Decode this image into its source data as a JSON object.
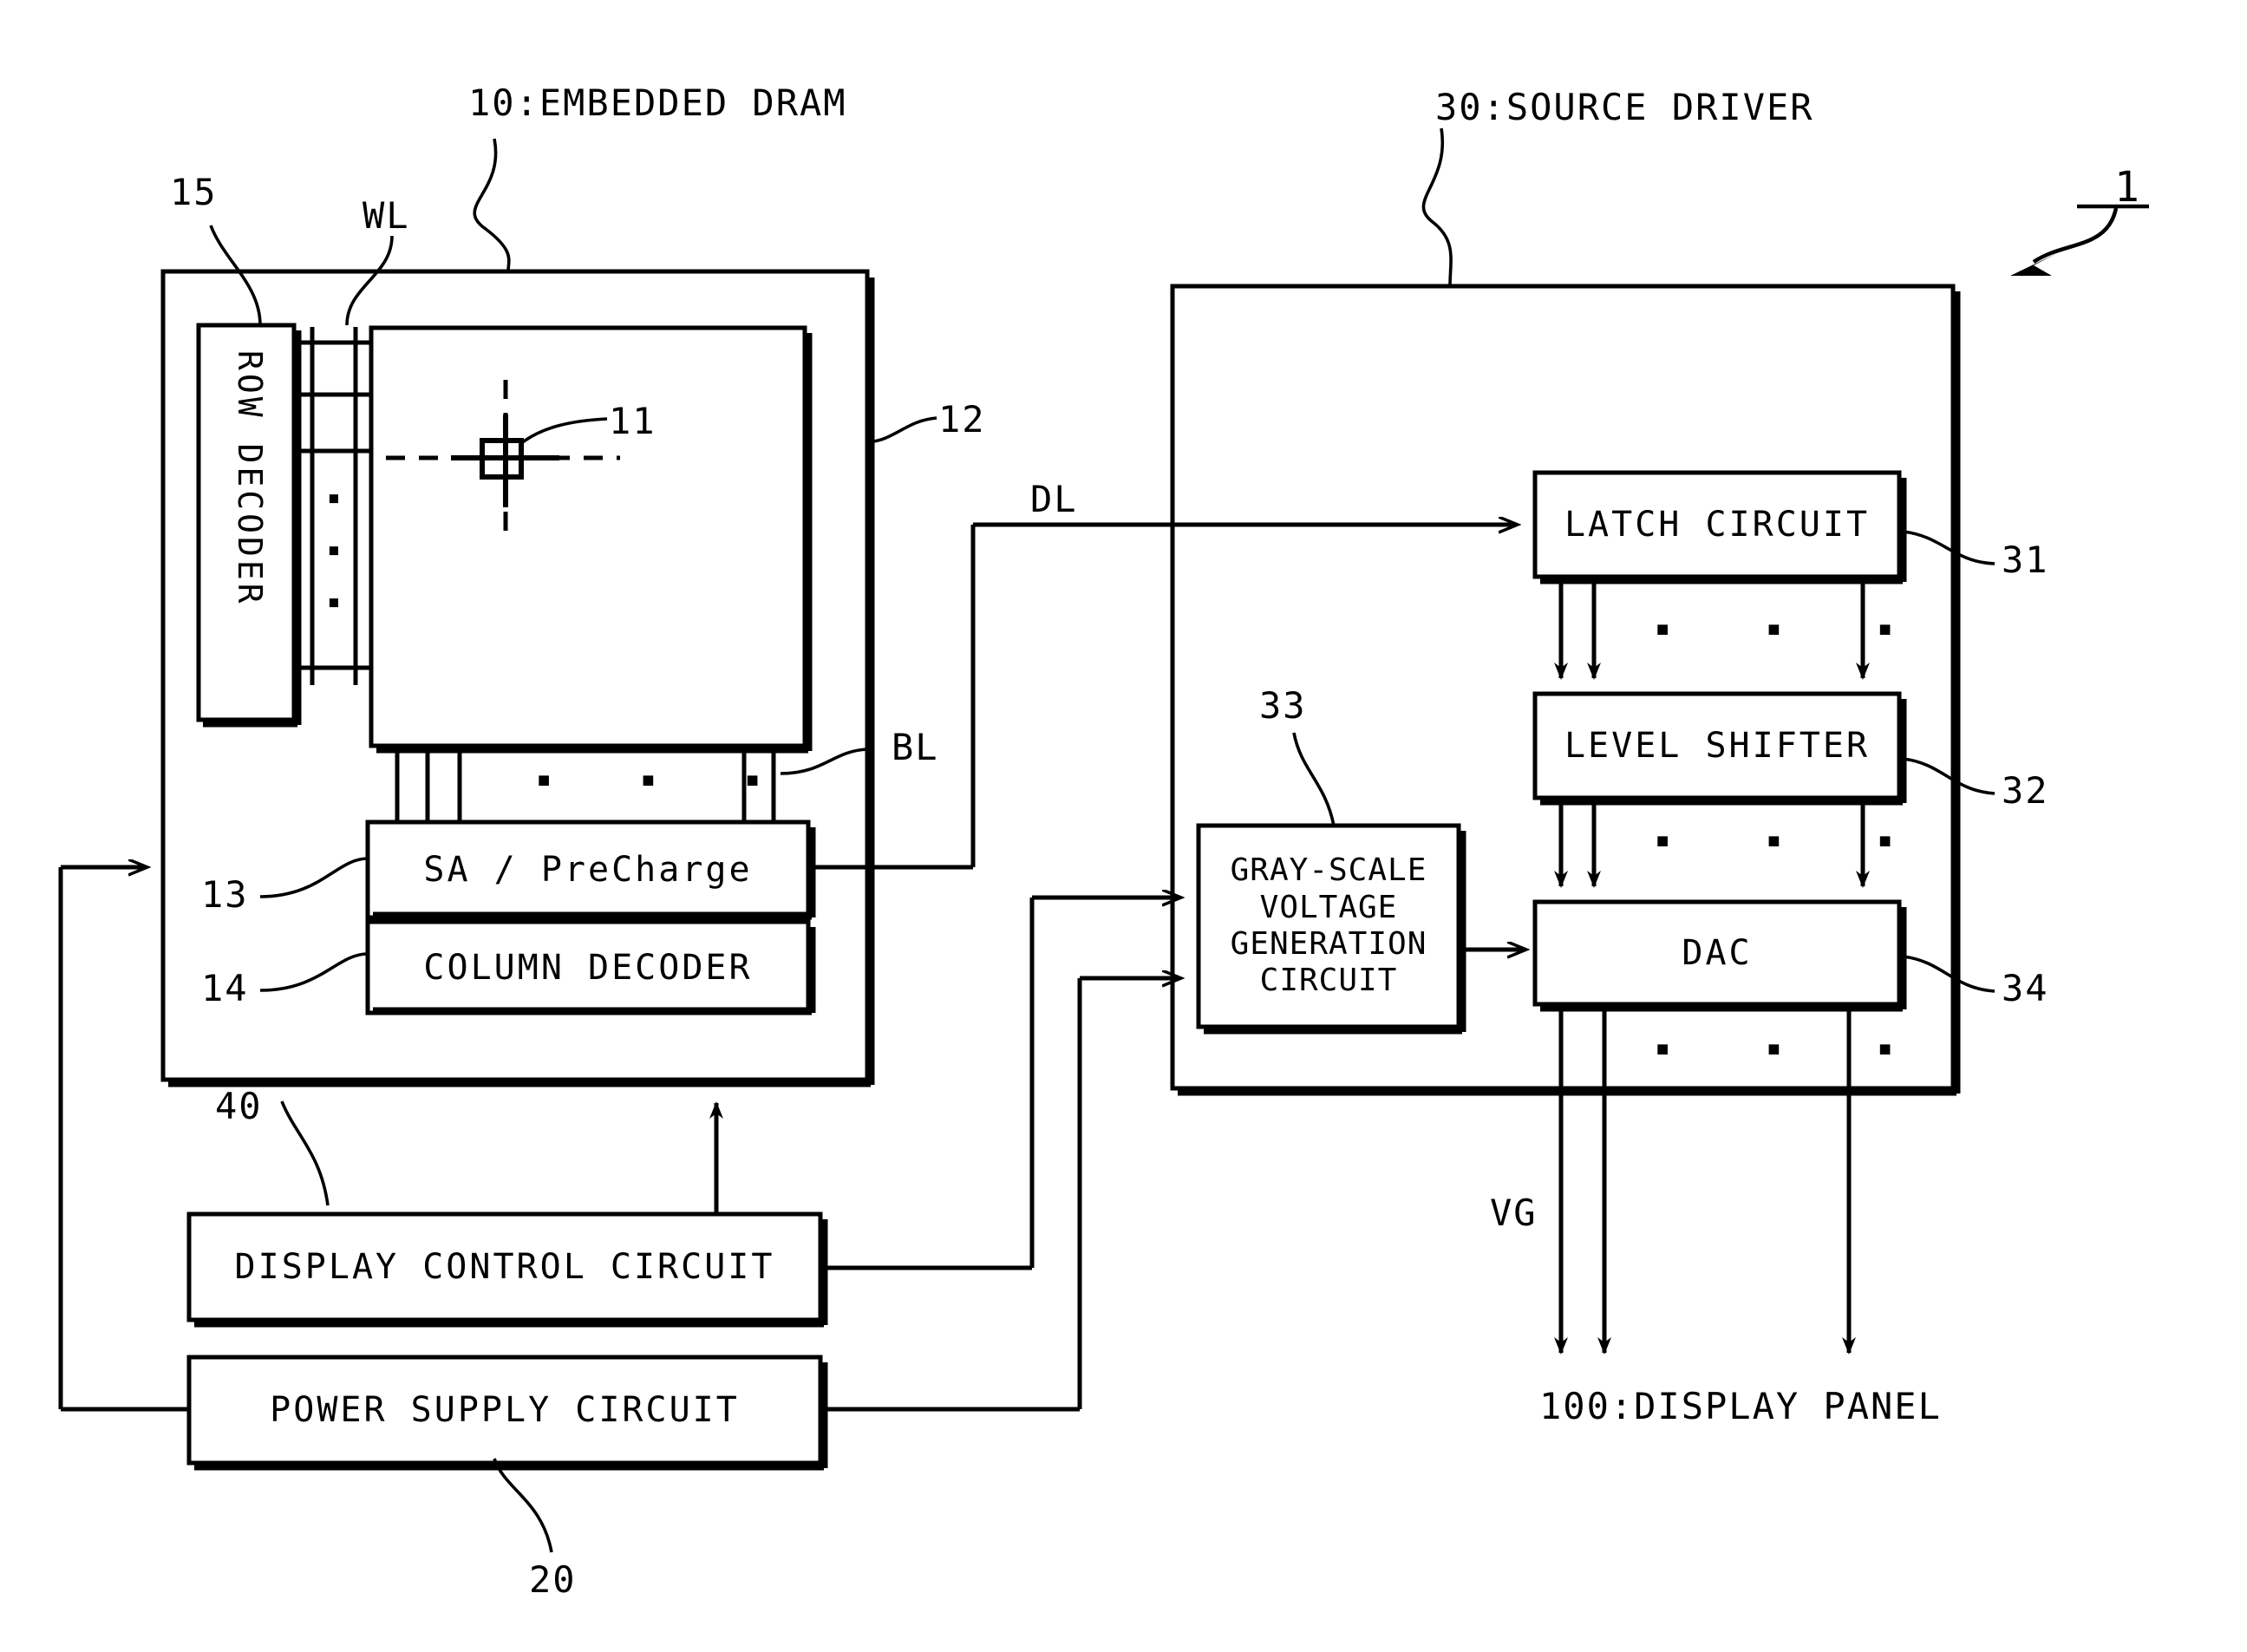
{
  "figure": {
    "type": "patent-block-diagram",
    "overall_ref": "1"
  },
  "titles": {
    "dram": "10:EMBEDDED DRAM",
    "source_driver": "30:SOURCE DRIVER",
    "display_panel": "100:DISPLAY PANEL"
  },
  "signals": {
    "wl": "WL",
    "bl": "BL",
    "dl": "DL",
    "vg": "VG"
  },
  "dram": {
    "row_decoder": "ROW DECODER",
    "sa_precharge": "SA / PreCharge",
    "column_decoder": "COLUMN DECODER",
    "refs": {
      "row_decoder": "15",
      "memory_cell": "11",
      "memory_array": "12",
      "sa_precharge": "13",
      "column_decoder": "14"
    },
    "ellipsis": "▪   ▪   ▪",
    "vertical_ellipsis": [
      "▪",
      "▪",
      "▪"
    ]
  },
  "source_driver": {
    "latch_circuit": "LATCH CIRCUIT",
    "level_shifter": "LEVEL SHIFTER",
    "dac": "DAC",
    "grayscale": "GRAY-SCALE\nVOLTAGE\nGENERATION\nCIRCUIT",
    "refs": {
      "latch_circuit": "31",
      "level_shifter": "32",
      "grayscale": "33",
      "dac": "34"
    },
    "ellipsis": "▪   ▪   ▪"
  },
  "bottom": {
    "display_control_circuit": "DISPLAY CONTROL CIRCUIT",
    "power_supply_circuit": "POWER SUPPLY CIRCUIT",
    "refs": {
      "display_control_circuit": "40",
      "power_supply_circuit": "20"
    }
  },
  "colors": {
    "ink": "#000000",
    "paper": "#ffffff"
  }
}
